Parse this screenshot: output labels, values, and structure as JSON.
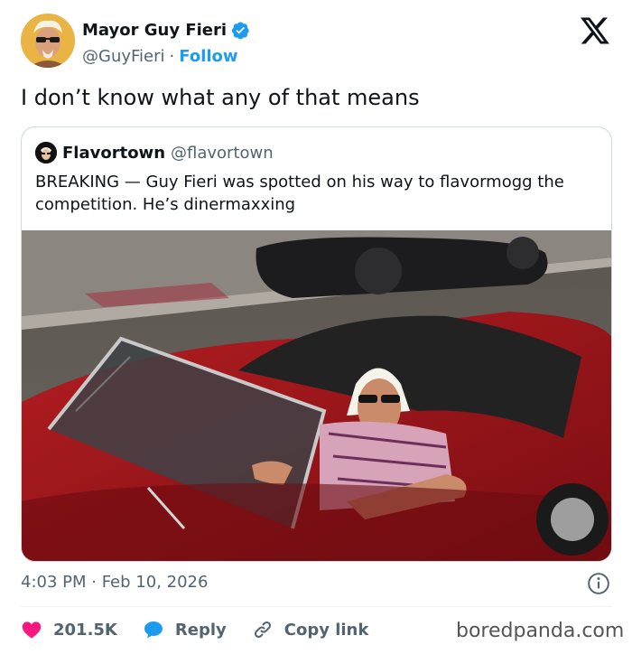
{
  "author": {
    "name": "Mayor Guy Fieri",
    "handle": "@GuyFieri",
    "separator": "·",
    "follow_label": "Follow"
  },
  "tweet": {
    "text": "I don’t know what any of that means",
    "timestamp": "4:03 PM · Feb 10, 2026"
  },
  "quoted": {
    "name": "Flavortown",
    "handle": "@flavortown",
    "text": "BREAKING — Guy Fieri was spotted on his way to flavormogg the competition. He’s dinermaxxing"
  },
  "actions": {
    "like_count": "201.5K",
    "reply_label": "Reply",
    "copy_label": "Copy link"
  },
  "watermark": "boredpanda.com",
  "icons": {
    "verified": "verified-badge-icon",
    "x_logo": "x-logo-icon",
    "info": "info-icon",
    "like": "heart-icon",
    "reply": "reply-bubble-icon",
    "copy": "link-icon"
  },
  "colors": {
    "accent": "#1d9bf0",
    "like": "#f91880",
    "text": "#0f1419",
    "secondary": "#536471",
    "border": "#cfd9de"
  }
}
